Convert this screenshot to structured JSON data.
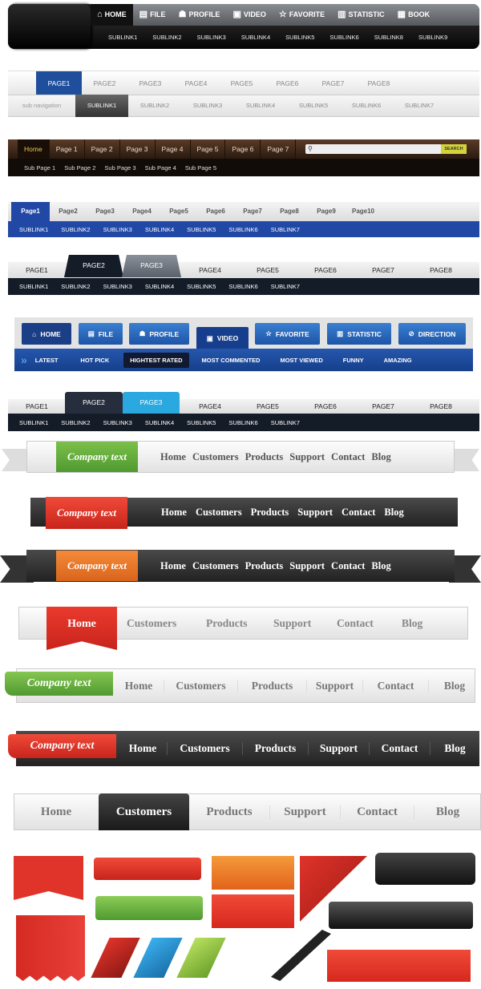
{
  "bar1": {
    "tabs": [
      {
        "icon": "home-icon",
        "label": "HOME"
      },
      {
        "icon": "file-icon",
        "label": "FILE"
      },
      {
        "icon": "profile-icon",
        "label": "PROFILE"
      },
      {
        "icon": "video-icon",
        "label": "VIDEO"
      },
      {
        "icon": "star-icon",
        "label": "FAVORITE"
      },
      {
        "icon": "chart-icon",
        "label": "STATISTIC"
      },
      {
        "icon": "book-icon",
        "label": "BOOK"
      }
    ],
    "sublinks": [
      "SUBLINK1",
      "SUBLINK2",
      "SUBLINK3",
      "SUBLINK4",
      "SUBLINK5",
      "SUBLINK6",
      "SUBLINK8",
      "SUBLINK9"
    ]
  },
  "bar2": {
    "pages": [
      "PAGE1",
      "PAGE2",
      "PAGE3",
      "PAGE4",
      "PAGE5",
      "PAGE6",
      "PAGE7",
      "PAGE8"
    ],
    "sub_label": "sub navigation",
    "sublinks": [
      "SUBLINK1",
      "SUBLINK2",
      "SUBLINK3",
      "SUBLINK4",
      "SUBLINK5",
      "SUBLINK6",
      "SUBLINK7"
    ]
  },
  "bar3": {
    "pages": [
      "Home",
      "Page 1",
      "Page 2",
      "Page 3",
      "Page 4",
      "Page 5",
      "Page 6",
      "Page 7"
    ],
    "search_button": "SEARCH",
    "sublinks": [
      "Sub Page 1",
      "Sub Page 2",
      "Sub Page 3",
      "Sub Page 4",
      "Sub Page 5"
    ]
  },
  "bar4": {
    "pages": [
      "Page1",
      "Page2",
      "Page3",
      "Page4",
      "Page5",
      "Page6",
      "Page7",
      "Page8",
      "Page9",
      "Page10"
    ],
    "sublinks": [
      "SUBLINK1",
      "SUBLINK2",
      "SUBLINK3",
      "SUBLINK4",
      "SUBLINK5",
      "SUBLINK6",
      "SUBLINK7"
    ]
  },
  "bar5": {
    "pages": [
      "PAGE1",
      "PAGE2",
      "PAGE3",
      "PAGE4",
      "PAGE5",
      "PAGE6",
      "PAGE7",
      "PAGE8"
    ],
    "sublinks": [
      "SUBLINK1",
      "SUBLINK2",
      "SUBLINK3",
      "SUBLINK4",
      "SUBLINK5",
      "SUBLINK6",
      "SUBLINK7"
    ]
  },
  "bar6": {
    "buttons": [
      {
        "icon": "home-icon",
        "label": "HOME"
      },
      {
        "icon": "file-icon",
        "label": "FILE"
      },
      {
        "icon": "profile-icon",
        "label": "PROFILE"
      },
      {
        "icon": "video-icon",
        "label": "VIDEO"
      },
      {
        "icon": "star-icon",
        "label": "FAVORITE"
      },
      {
        "icon": "chart-icon",
        "label": "STATISTIC"
      },
      {
        "icon": "direction-icon",
        "label": "DIRECTION"
      }
    ],
    "sublinks": [
      "LATEST",
      "HOT PICK",
      "HIGHTEST RATED",
      "MOST COMMENTED",
      "MOST VIEWED",
      "FUNNY",
      "AMAZING"
    ]
  },
  "bar7": {
    "pages": [
      "PAGE1",
      "PAGE2",
      "PAGE3",
      "PAGE4",
      "PAGE5",
      "PAGE6",
      "PAGE7",
      "PAGE8"
    ],
    "sublinks": [
      "SUBLINK1",
      "SUBLINK2",
      "SUBLINK3",
      "SUBLINK4",
      "SUBLINK5",
      "SUBLINK6",
      "SUBLINK7"
    ]
  },
  "ribbons": {
    "company": "Company text",
    "items": [
      "Home",
      "Customers",
      "Products",
      "Support",
      "Contact",
      "Blog"
    ]
  },
  "colors": {
    "blue": "#1f4f9c",
    "green": "#5ea83a",
    "red": "#e0332a",
    "orange": "#e8772a",
    "dark": "#2a2a2a",
    "cyan": "#2aa8e0"
  }
}
